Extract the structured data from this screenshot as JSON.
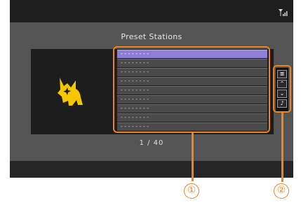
{
  "screen": {
    "title": "Preset Stations",
    "page_indicator": "1 / 40",
    "signal_icon": "signal-strength-icon",
    "station_icon": "dog-logo-icon"
  },
  "preset_list": {
    "rows": [
      {
        "label": "--------",
        "selected": true
      },
      {
        "label": "--------",
        "selected": false
      },
      {
        "label": "--------",
        "selected": false
      },
      {
        "label": "--------",
        "selected": false
      },
      {
        "label": "--------",
        "selected": false
      },
      {
        "label": "--------",
        "selected": false
      },
      {
        "label": "--------",
        "selected": false
      },
      {
        "label": "--------",
        "selected": false
      },
      {
        "label": "--------",
        "selected": false
      }
    ]
  },
  "side_buttons": {
    "menu": "≣",
    "up": "⌃",
    "down": "⌄",
    "music": "♪"
  },
  "callouts": {
    "one": "①",
    "two": "②"
  },
  "colors": {
    "accent": "#f0831f",
    "selected_row": "#8e7fd6",
    "logo_yellow": "#f6c700"
  }
}
